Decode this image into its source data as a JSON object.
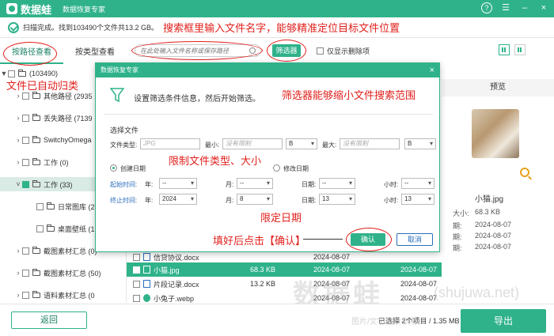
{
  "titlebar": {
    "logo": "数据蛙",
    "title": "数据恢复专家",
    "help": "?",
    "menu": "☰",
    "minimize": "–",
    "close": "×"
  },
  "scan": {
    "status": "扫描完成。找到103490个文件共13.2 GB。",
    "annotation": "搜索框里输入文件名字，能够精准定位目标文件位置"
  },
  "tabs": [
    {
      "label": "按路径查看",
      "active": true
    },
    {
      "label": "按类型查看",
      "active": false
    }
  ],
  "search": {
    "placeholder": "在此处输入文件名称或保存路径",
    "filter_label": "筛选器",
    "only_deleted": "仅显示删除项"
  },
  "tree": {
    "root": "(103490)",
    "annotation": "文件已自动归类",
    "items": [
      {
        "label": "其他路径 (2935",
        "indent": 1
      },
      {
        "label": "丢失路径 (7139",
        "indent": 1
      },
      {
        "label": "SwitchyOmega",
        "indent": 1
      },
      {
        "label": "工作 (0)",
        "indent": 1
      },
      {
        "label": "工作 (33)",
        "indent": 1,
        "selected": true
      },
      {
        "label": "日常图库 (2",
        "indent": 2
      },
      {
        "label": "桌面壁纸 (1",
        "indent": 2
      },
      {
        "label": "截图素材汇总 (0)",
        "indent": 1
      },
      {
        "label": "截图素材汇总 (50)",
        "indent": 1
      },
      {
        "label": "语料素材汇总 (0",
        "indent": 1
      }
    ]
  },
  "files": [
    {
      "name": "信贷协议.docx",
      "size": "",
      "date": "2024-08-07",
      "date2": ""
    },
    {
      "name": "小猫.jpg",
      "size": "68.3 KB",
      "date": "2024-08-07",
      "date2": "2024-08-07",
      "selected": true
    },
    {
      "name": "片段记录.docx",
      "size": "13.2 KB",
      "date": "2024-08-07",
      "date2": "2024-08-07"
    },
    {
      "name": "小兔子.webp",
      "size": "",
      "date": "2024-08-07",
      "date2": "2024-08-07"
    }
  ],
  "preview": {
    "header": "预览",
    "name": "小猫.jpg",
    "meta": [
      {
        "label": "大小:",
        "value": "68.3 KB"
      },
      {
        "label": "期:",
        "value": "2024-08-07"
      },
      {
        "label": "期:",
        "value": "2024-08-07"
      },
      {
        "label": "期:",
        "value": "2024-08-07"
      }
    ]
  },
  "modal": {
    "title": "数据恢复专家",
    "close": "×",
    "desc": "设置筛选条件信息，然后开始筛选。",
    "annotation_filter": "筛选器能够缩小文件搜索范围",
    "section": "选择文件",
    "file_type_label": "文件类型:",
    "file_type_placeholder": "JPG",
    "min_label": "最小:",
    "min_placeholder": "没有限制",
    "min_unit": "B",
    "max_label": "最大:",
    "max_placeholder": "没有限制",
    "max_unit": "B",
    "annotation_limit": "限制文件类型、大小",
    "created_label": "创建日期",
    "modified_label": "修改日期",
    "start_label": "起始时间:",
    "end_label": "终止时间:",
    "year_label": "年:",
    "month_label": "月:",
    "day_label": "日期:",
    "hour_label": "小时:",
    "start": {
      "year": "--",
      "month": "--",
      "day": "--",
      "hour": "--"
    },
    "end": {
      "year": "2024",
      "month": "8",
      "day": "13",
      "hour": "13"
    },
    "annotation_date": "限定日期",
    "annotation_ok": "填好后点击【确认】",
    "ok": "确认",
    "cancel": "取消"
  },
  "bottom": {
    "back": "返回",
    "selection": "已选择 2个项目 / 1.35 MB",
    "export": "导出",
    "watermark": "数据蛙",
    "watermark_url": "(shujuwa.net)",
    "watermark_note": "图片/文字仅供参考，"
  },
  "colors": {
    "accent": "#2fb28a",
    "annotation": "#e0201c",
    "link": "#2a6ebb"
  }
}
